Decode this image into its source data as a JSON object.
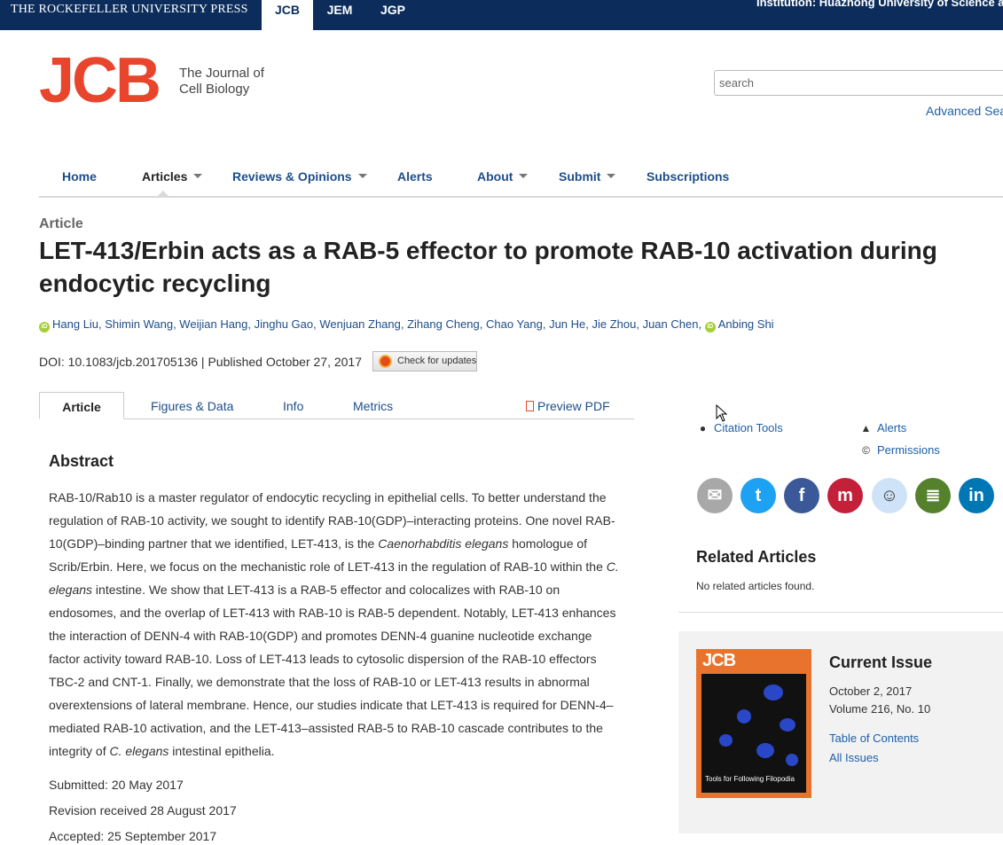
{
  "topbar": {
    "press": "THE ROCKEFELLER UNIVERSITY PRESS",
    "tabs": [
      "JCB",
      "JEM",
      "JGP"
    ],
    "institution": "Institution: Huazhong University of Science and"
  },
  "logo": {
    "mark": "JCB",
    "line1": "The Journal of",
    "line2": "Cell Biology"
  },
  "search": {
    "placeholder": "search",
    "advanced": "Advanced Sea"
  },
  "nav": [
    "Home",
    "Articles",
    "Reviews & Opinions",
    "Alerts",
    "About",
    "Submit",
    "Subscriptions"
  ],
  "article": {
    "type": "Article",
    "title_l1": "LET-413/Erbin acts as a RAB-5 effector to promote RAB-10 activation during",
    "title_l2": "endocytic recycling",
    "authors_main": "Hang Liu, Shimin Wang, Weijian Hang, Jinghu Gao, Wenjuan Zhang, Zihang Cheng, Chao Yang, Jun He, Jie Zhou, Juan Chen,",
    "author_last": "Anbing Shi",
    "orcid_label": "iD",
    "doi": "DOI: 10.1083/jcb.201705136 | Published October 27, 2017",
    "check_updates": "Check for updates"
  },
  "tabs": {
    "article": "Article",
    "figures": "Figures & Data",
    "info": "Info",
    "metrics": "Metrics",
    "pdf": "Preview PDF"
  },
  "abstract": {
    "heading": "Abstract",
    "p1": "RAB-10/Rab10 is a master regulator of endocytic recycling in epithelial cells. To better understand the regulation of RAB-10 activity, we sought to identify RAB-10(GDP)–interacting proteins. One novel RAB-10(GDP)–binding partner that we identified, LET-413, is the ",
    "i1": "Caenorhabditis elegans",
    "p2": " homologue of Scrib/Erbin. Here, we focus on the mechanistic role of LET-413 in the regulation of RAB-10 within the ",
    "i2": "C. elegans",
    "p3": " intestine. We show that LET-413 is a RAB-5 effector and colocalizes with RAB-10 on endosomes, and the overlap of LET-413 with RAB-10 is RAB-5 dependent. Notably, LET-413 enhances the interaction of DENN-4 with RAB-10(GDP) and promotes DENN-4 guanine nucleotide exchange factor activity toward RAB-10. Loss of LET-413 leads to cytosolic dispersion of the RAB-10 effectors TBC-2 and CNT-1. Finally, we demonstrate that the loss of RAB-10 or LET-413 results in abnormal overextensions of lateral membrane. Hence, our studies indicate that LET-413 is required for DENN-4–mediated RAB-10 activation, and the LET-413–assisted RAB-5 to RAB-10 cascade contributes to the integrity of ",
    "i3": "C. elegans",
    "p4": " intestinal epithelia."
  },
  "dates": {
    "submitted": "Submitted: 20 May 2017",
    "revision": "Revision received 28 August 2017",
    "accepted": "Accepted: 25 September 2017"
  },
  "sidebar": {
    "citation_tools": "Citation Tools",
    "alerts": "Alerts",
    "permissions": "Permissions",
    "share_icons": [
      "email",
      "twitter",
      "facebook",
      "mendeley",
      "reddit",
      "notes",
      "linkedin"
    ],
    "share_glyphs": [
      "✉",
      "t",
      "f",
      "m",
      "☺",
      "≣",
      "in"
    ],
    "share_colors": [
      "#a8a8a8",
      "#1da1f2",
      "#3b5998",
      "#c4203a",
      "#cee3f8",
      "#55802c",
      "#0077b5"
    ],
    "related_heading": "Related Articles",
    "related_none": "No related articles found.",
    "current_issue": {
      "heading": "Current Issue",
      "date": "October 2, 2017",
      "volume": "Volume 216, No. 10",
      "toc": "Table of Contents",
      "all": "All Issues",
      "cover_mark": "JCB",
      "cover_caption": "Tools for Following Filopodia"
    }
  }
}
